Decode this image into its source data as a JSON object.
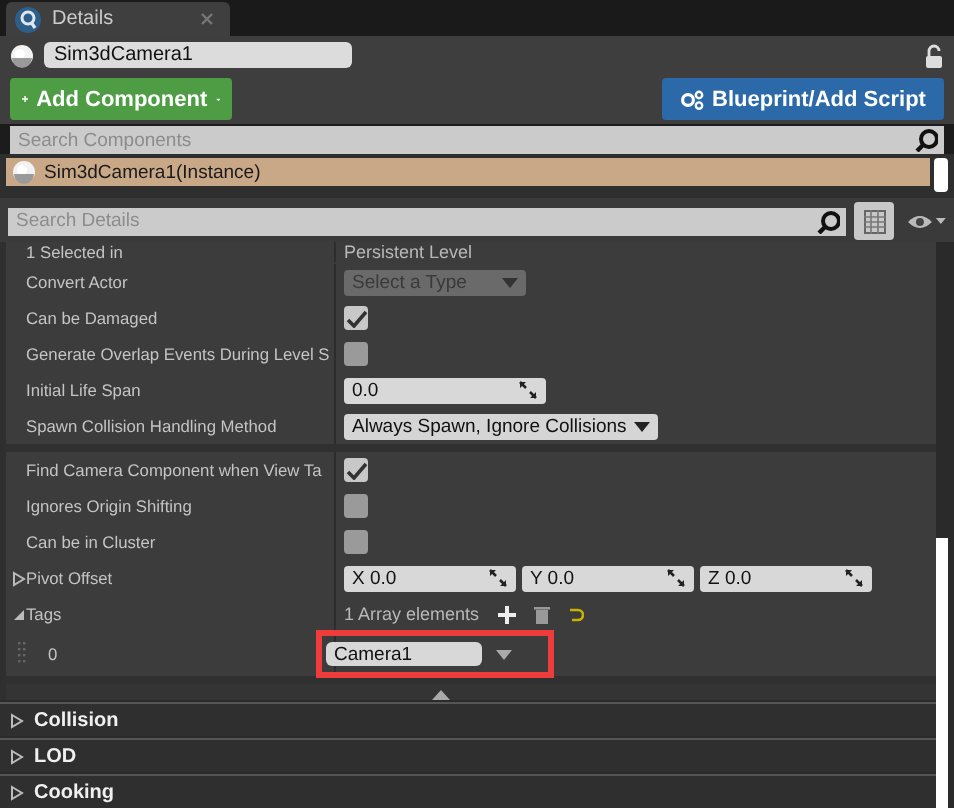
{
  "tab": {
    "title": "Details"
  },
  "actor": {
    "name": "Sim3dCamera1"
  },
  "buttons": [
    {
      "kind": "add",
      "label": "Add Component"
    },
    {
      "kind": "blueprint",
      "label": "Blueprint/Add Script"
    }
  ],
  "search_components": {
    "placeholder": "Search Components"
  },
  "components": [
    {
      "label": "Sim3dCamera1(Instance)",
      "selected": true
    }
  ],
  "search_details": {
    "placeholder": "Search Details"
  },
  "groups": [
    {
      "rows": [
        {
          "kind": "text",
          "label": "1 Selected in",
          "value": "Persistent Level"
        },
        {
          "kind": "dropdown",
          "label": "Convert Actor",
          "value": "Select a Type",
          "disabled": true
        },
        {
          "kind": "checkbox",
          "label": "Can be Damaged",
          "checked": true
        },
        {
          "kind": "checkbox",
          "label": "Generate Overlap Events During Level S",
          "checked": false
        },
        {
          "kind": "number",
          "label": "Initial Life Span",
          "value": "0.0"
        },
        {
          "kind": "dropdown",
          "label": "Spawn Collision Handling Method",
          "value": "Always Spawn, Ignore Collisions",
          "disabled": false
        }
      ]
    },
    {
      "rows": [
        {
          "kind": "checkbox",
          "label": "Find Camera Component when View Ta",
          "checked": true
        },
        {
          "kind": "checkbox",
          "label": "Ignores Origin Shifting",
          "checked": false
        },
        {
          "kind": "checkbox",
          "label": "Can be in Cluster",
          "checked": false
        },
        {
          "kind": "vector",
          "label": "Pivot Offset",
          "expanded": false,
          "fields": [
            {
              "axis": "X",
              "value": "0.0"
            },
            {
              "axis": "Y",
              "value": "0.0"
            },
            {
              "axis": "Z",
              "value": "0.0"
            }
          ]
        },
        {
          "kind": "array",
          "label": "Tags",
          "expanded": true,
          "value": "1 Array elements",
          "children": [
            {
              "index": "0",
              "value": "Camera1",
              "highlighted": true
            }
          ]
        }
      ]
    }
  ],
  "categories": [
    {
      "label": "Collision",
      "expanded": false
    },
    {
      "label": "LOD",
      "expanded": false
    },
    {
      "label": "Cooking",
      "expanded": false
    }
  ]
}
